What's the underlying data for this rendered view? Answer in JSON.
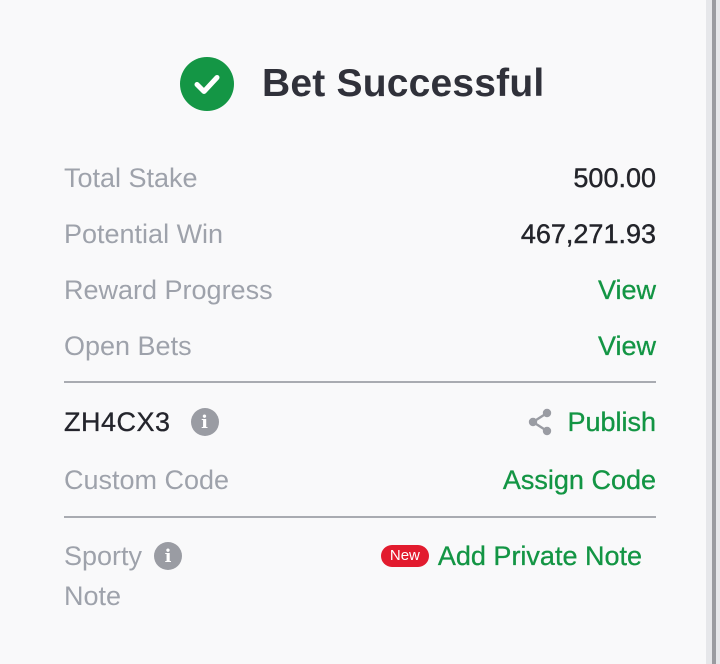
{
  "header": {
    "title": "Bet Successful",
    "status_icon": "check-circle-icon",
    "status_color": "#149645"
  },
  "summary": {
    "total_stake": {
      "label": "Total Stake",
      "value": "500.00"
    },
    "potential_win": {
      "label": "Potential Win",
      "value": "467,271.93"
    },
    "reward_progress": {
      "label": "Reward Progress",
      "link": "View"
    },
    "open_bets": {
      "label": "Open Bets",
      "link": "View"
    }
  },
  "booking": {
    "code": "ZH4CX3",
    "info_icon": "info-icon",
    "share_icon": "share-icon",
    "publish_label": "Publish",
    "custom_code_label": "Custom Code",
    "assign_code_label": "Assign Code"
  },
  "note": {
    "label_line1": "Sporty",
    "label_line2": "Note",
    "badge": "New",
    "add_label": "Add Private Note"
  },
  "colors": {
    "accent_green": "#139544",
    "badge_red": "#e21b2e",
    "muted_text": "#9ea2ab"
  }
}
